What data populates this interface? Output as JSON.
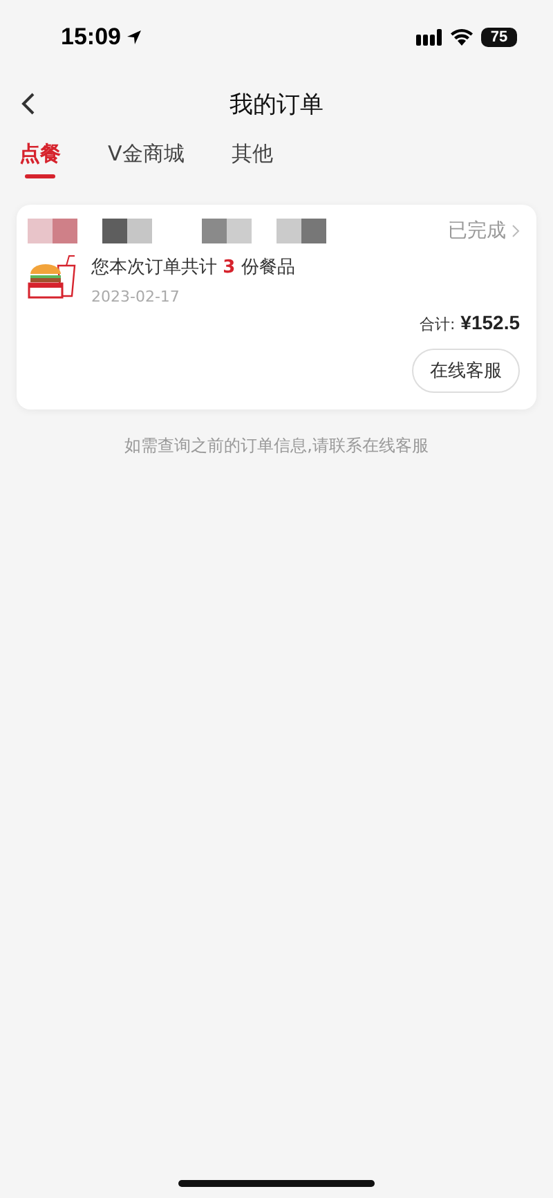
{
  "status_bar": {
    "time": "15:09",
    "battery": "75"
  },
  "header": {
    "title": "我的订单"
  },
  "tabs": [
    {
      "label": "点餐",
      "selected": true
    },
    {
      "label": "V金商城",
      "selected": false
    },
    {
      "label": "其他",
      "selected": false
    }
  ],
  "orders": [
    {
      "status": "已完成",
      "summary": "您本次订单共计 **3** 份餐品",
      "date": "2023-02-17",
      "total_label": "合计:",
      "total": "¥152.5",
      "button": "在线客服"
    }
  ],
  "footer_note": "如需查询之前的订单信息,请联系在线客服"
}
